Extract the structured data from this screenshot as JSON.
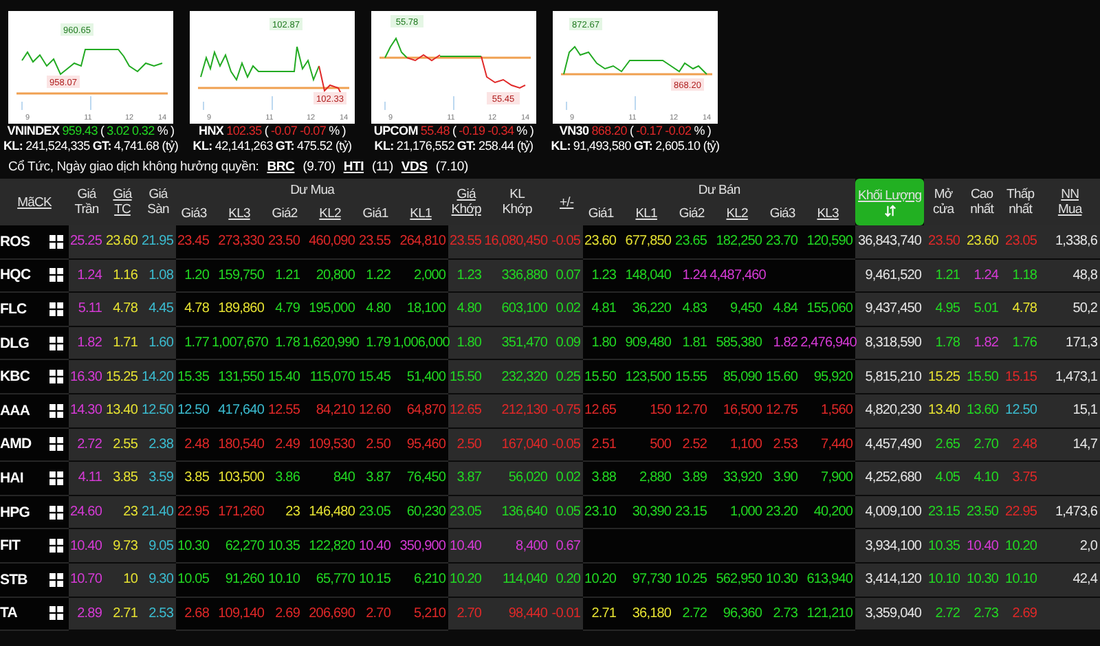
{
  "indices": [
    {
      "name": "VNINDEX",
      "value": "959.43",
      "color": "#22d822",
      "brackets": [
        "(",
        ")"
      ],
      "change": "3.02",
      "percent": "0.32",
      "unit": "%",
      "kl_label": "KL:",
      "kl": "241,524,335",
      "gt_label": "GT:",
      "gt": "4,741.68 (tỷ)",
      "high": "960.65",
      "low": "958.07",
      "ticks": [
        "9",
        "11",
        "12",
        "14"
      ]
    },
    {
      "name": "HNX",
      "value": "102.35",
      "color": "#e02828",
      "brackets": [
        "(",
        ")"
      ],
      "change": "-0.07",
      "percent": "-0.07",
      "unit": "%",
      "kl_label": "KL:",
      "kl": "42,141,263",
      "gt_label": "GT:",
      "gt": "475.52 (tỷ)",
      "high": "102.87",
      "low": "102.33",
      "ticks": [
        "9",
        "11",
        "12",
        "14"
      ]
    },
    {
      "name": "UPCOM",
      "value": "55.48",
      "color": "#e02828",
      "brackets": [
        "(",
        ")"
      ],
      "change": "-0.19",
      "percent": "-0.34",
      "unit": "%",
      "kl_label": "KL:",
      "kl": "21,176,552",
      "gt_label": "GT:",
      "gt": "258.44 (tỷ)",
      "high": "55.78",
      "low": "55.45",
      "ticks": [
        "9",
        "11",
        "12",
        "14"
      ]
    },
    {
      "name": "VN30",
      "value": "868.20",
      "color": "#e02828",
      "brackets": [
        "(",
        ")"
      ],
      "change": "-0.17",
      "percent": "-0.02",
      "unit": "%",
      "kl_label": "KL:",
      "kl": "91,493,580",
      "gt_label": "GT:",
      "gt": "2,605.10 (tỷ)",
      "high": "872.67",
      "low": "868.20",
      "ticks": [
        "9",
        "11",
        "12",
        "14"
      ]
    }
  ],
  "notice": {
    "label": "Cổ Tức, Ngày giao dịch không hưởng quyền:",
    "items": [
      {
        "symbol": "BRC",
        "value": "(9.70)"
      },
      {
        "symbol": "HTI",
        "value": "(11)"
      },
      {
        "symbol": "VDS",
        "value": "(7.10)"
      }
    ]
  },
  "table": {
    "columns": [
      {
        "label": "MãCK",
        "link": true,
        "sorted": false
      },
      {
        "label": "Giá\nTrần",
        "link": false,
        "sorted": false
      },
      {
        "label": "Giá\nTC",
        "link": true,
        "sorted": false
      },
      {
        "label": "Giá\nSàn",
        "link": false,
        "sorted": false
      },
      {
        "label": "Giá3",
        "link": false,
        "sorted": false
      },
      {
        "label": "KL3",
        "link": true,
        "sorted": false
      },
      {
        "label": "Giá2",
        "link": false,
        "sorted": false
      },
      {
        "label": "KL2",
        "link": true,
        "sorted": false
      },
      {
        "label": "Giá1",
        "link": false,
        "sorted": false
      },
      {
        "label": "KL1",
        "link": true,
        "sorted": false
      },
      {
        "label": "Giá\nKhớp",
        "link": true,
        "sorted": false
      },
      {
        "label": "KL\nKhớp",
        "link": false,
        "sorted": false
      },
      {
        "label": "+/-",
        "link": true,
        "sorted": false
      },
      {
        "label": "Giá1",
        "link": false,
        "sorted": false
      },
      {
        "label": "KL1",
        "link": true,
        "sorted": false
      },
      {
        "label": "Giá2",
        "link": false,
        "sorted": false
      },
      {
        "label": "KL2",
        "link": true,
        "sorted": false
      },
      {
        "label": "Giá3",
        "link": false,
        "sorted": false
      },
      {
        "label": "KL3",
        "link": true,
        "sorted": false
      },
      {
        "label": "Khối Lượng",
        "link": true,
        "sorted": true
      },
      {
        "label": "Mở\ncửa",
        "link": false,
        "sorted": false
      },
      {
        "label": "Cao\nnhất",
        "link": false,
        "sorted": false
      },
      {
        "label": "Thấp\nnhất",
        "link": false,
        "sorted": false
      },
      {
        "label": "NN\nMua",
        "link": true,
        "sorted": false
      }
    ],
    "column_groups": [
      {
        "label": "Dư Mua"
      },
      {
        "label": "Dư Bán"
      }
    ],
    "rows": [
      {
        "cells": [
          {
            "text": "ROS"
          },
          {
            "text": "25.25",
            "color": "#d63ad6"
          },
          {
            "text": "23.60",
            "color": "#e6e232"
          },
          {
            "text": "21.95",
            "color": "#3bbcd0"
          },
          {
            "text": "23.45",
            "color": "#e02828"
          },
          {
            "text": "273,330",
            "color": "#e02828"
          },
          {
            "text": "23.50",
            "color": "#e02828"
          },
          {
            "text": "460,090",
            "color": "#e02828"
          },
          {
            "text": "23.55",
            "color": "#e02828"
          },
          {
            "text": "264,810",
            "color": "#e02828"
          },
          {
            "text": "23.55",
            "color": "#e02828"
          },
          {
            "text": "16,080,450",
            "color": "#e02828"
          },
          {
            "text": "-0.05",
            "color": "#e02828"
          },
          {
            "text": "23.60",
            "color": "#e6e232"
          },
          {
            "text": "677,850",
            "color": "#e6e232"
          },
          {
            "text": "23.65",
            "color": "#22d822"
          },
          {
            "text": "182,250",
            "color": "#22d822"
          },
          {
            "text": "23.70",
            "color": "#22d822"
          },
          {
            "text": "120,590",
            "color": "#22d822"
          },
          {
            "text": "36,843,740",
            "color": "#e6e6e6"
          },
          {
            "text": "23.50",
            "color": "#e02828"
          },
          {
            "text": "23.60",
            "color": "#e6e232"
          },
          {
            "text": "23.05",
            "color": "#e02828"
          },
          {
            "text": "1,338,6",
            "color": "#e6e6e6"
          }
        ]
      },
      {
        "cells": [
          {
            "text": "HQC"
          },
          {
            "text": "1.24",
            "color": "#d63ad6"
          },
          {
            "text": "1.16",
            "color": "#e6e232"
          },
          {
            "text": "1.08",
            "color": "#3bbcd0"
          },
          {
            "text": "1.20",
            "color": "#22d822"
          },
          {
            "text": "159,750",
            "color": "#22d822"
          },
          {
            "text": "1.21",
            "color": "#22d822"
          },
          {
            "text": "20,800",
            "color": "#22d822"
          },
          {
            "text": "1.22",
            "color": "#22d822"
          },
          {
            "text": "2,000",
            "color": "#22d822"
          },
          {
            "text": "1.23",
            "color": "#22d822"
          },
          {
            "text": "336,880",
            "color": "#22d822"
          },
          {
            "text": "0.07",
            "color": "#22d822"
          },
          {
            "text": "1.23",
            "color": "#22d822"
          },
          {
            "text": "148,040",
            "color": "#22d822"
          },
          {
            "text": "1.24",
            "color": "#d63ad6"
          },
          {
            "text": "4,487,460",
            "color": "#d63ad6"
          },
          null,
          null,
          {
            "text": "9,461,520",
            "color": "#e6e6e6"
          },
          {
            "text": "1.21",
            "color": "#22d822"
          },
          {
            "text": "1.24",
            "color": "#d63ad6"
          },
          {
            "text": "1.18",
            "color": "#22d822"
          },
          {
            "text": "48,8",
            "color": "#e6e6e6"
          }
        ]
      },
      {
        "cells": [
          {
            "text": "FLC"
          },
          {
            "text": "5.11",
            "color": "#d63ad6"
          },
          {
            "text": "4.78",
            "color": "#e6e232"
          },
          {
            "text": "4.45",
            "color": "#3bbcd0"
          },
          {
            "text": "4.78",
            "color": "#e6e232"
          },
          {
            "text": "189,860",
            "color": "#e6e232"
          },
          {
            "text": "4.79",
            "color": "#22d822"
          },
          {
            "text": "195,000",
            "color": "#22d822"
          },
          {
            "text": "4.80",
            "color": "#22d822"
          },
          {
            "text": "18,100",
            "color": "#22d822"
          },
          {
            "text": "4.80",
            "color": "#22d822"
          },
          {
            "text": "603,100",
            "color": "#22d822"
          },
          {
            "text": "0.02",
            "color": "#22d822"
          },
          {
            "text": "4.81",
            "color": "#22d822"
          },
          {
            "text": "36,220",
            "color": "#22d822"
          },
          {
            "text": "4.83",
            "color": "#22d822"
          },
          {
            "text": "9,450",
            "color": "#22d822"
          },
          {
            "text": "4.84",
            "color": "#22d822"
          },
          {
            "text": "155,060",
            "color": "#22d822"
          },
          {
            "text": "9,437,450",
            "color": "#e6e6e6"
          },
          {
            "text": "4.95",
            "color": "#22d822"
          },
          {
            "text": "5.01",
            "color": "#22d822"
          },
          {
            "text": "4.78",
            "color": "#e6e232"
          },
          {
            "text": "50,2",
            "color": "#e6e6e6"
          }
        ]
      },
      {
        "cells": [
          {
            "text": "DLG"
          },
          {
            "text": "1.82",
            "color": "#d63ad6"
          },
          {
            "text": "1.71",
            "color": "#e6e232"
          },
          {
            "text": "1.60",
            "color": "#3bbcd0"
          },
          {
            "text": "1.77",
            "color": "#22d822"
          },
          {
            "text": "1,007,670",
            "color": "#22d822"
          },
          {
            "text": "1.78",
            "color": "#22d822"
          },
          {
            "text": "1,620,990",
            "color": "#22d822"
          },
          {
            "text": "1.79",
            "color": "#22d822"
          },
          {
            "text": "1,006,000",
            "color": "#22d822"
          },
          {
            "text": "1.80",
            "color": "#22d822"
          },
          {
            "text": "351,470",
            "color": "#22d822"
          },
          {
            "text": "0.09",
            "color": "#22d822"
          },
          {
            "text": "1.80",
            "color": "#22d822"
          },
          {
            "text": "909,480",
            "color": "#22d822"
          },
          {
            "text": "1.81",
            "color": "#22d822"
          },
          {
            "text": "585,380",
            "color": "#22d822"
          },
          {
            "text": "1.82",
            "color": "#d63ad6"
          },
          {
            "text": "2,476,940",
            "color": "#d63ad6"
          },
          {
            "text": "8,318,590",
            "color": "#e6e6e6"
          },
          {
            "text": "1.78",
            "color": "#22d822"
          },
          {
            "text": "1.82",
            "color": "#d63ad6"
          },
          {
            "text": "1.76",
            "color": "#22d822"
          },
          {
            "text": "171,3",
            "color": "#e6e6e6"
          }
        ]
      },
      {
        "cells": [
          {
            "text": "KBC"
          },
          {
            "text": "16.30",
            "color": "#d63ad6"
          },
          {
            "text": "15.25",
            "color": "#e6e232"
          },
          {
            "text": "14.20",
            "color": "#3bbcd0"
          },
          {
            "text": "15.35",
            "color": "#22d822"
          },
          {
            "text": "131,550",
            "color": "#22d822"
          },
          {
            "text": "15.40",
            "color": "#22d822"
          },
          {
            "text": "115,070",
            "color": "#22d822"
          },
          {
            "text": "15.45",
            "color": "#22d822"
          },
          {
            "text": "51,400",
            "color": "#22d822"
          },
          {
            "text": "15.50",
            "color": "#22d822"
          },
          {
            "text": "232,320",
            "color": "#22d822"
          },
          {
            "text": "0.25",
            "color": "#22d822"
          },
          {
            "text": "15.50",
            "color": "#22d822"
          },
          {
            "text": "123,500",
            "color": "#22d822"
          },
          {
            "text": "15.55",
            "color": "#22d822"
          },
          {
            "text": "85,090",
            "color": "#22d822"
          },
          {
            "text": "15.60",
            "color": "#22d822"
          },
          {
            "text": "95,920",
            "color": "#22d822"
          },
          {
            "text": "5,815,210",
            "color": "#e6e6e6"
          },
          {
            "text": "15.25",
            "color": "#e6e232"
          },
          {
            "text": "15.50",
            "color": "#22d822"
          },
          {
            "text": "15.15",
            "color": "#e02828"
          },
          {
            "text": "1,473,1",
            "color": "#e6e6e6"
          }
        ]
      },
      {
        "cells": [
          {
            "text": "AAA"
          },
          {
            "text": "14.30",
            "color": "#d63ad6"
          },
          {
            "text": "13.40",
            "color": "#e6e232"
          },
          {
            "text": "12.50",
            "color": "#3bbcd0"
          },
          {
            "text": "12.50",
            "color": "#3bbcd0"
          },
          {
            "text": "417,640",
            "color": "#3bbcd0"
          },
          {
            "text": "12.55",
            "color": "#e02828"
          },
          {
            "text": "84,210",
            "color": "#e02828"
          },
          {
            "text": "12.60",
            "color": "#e02828"
          },
          {
            "text": "64,870",
            "color": "#e02828"
          },
          {
            "text": "12.65",
            "color": "#e02828"
          },
          {
            "text": "212,130",
            "color": "#e02828"
          },
          {
            "text": "-0.75",
            "color": "#e02828"
          },
          {
            "text": "12.65",
            "color": "#e02828"
          },
          {
            "text": "150",
            "color": "#e02828"
          },
          {
            "text": "12.70",
            "color": "#e02828"
          },
          {
            "text": "16,500",
            "color": "#e02828"
          },
          {
            "text": "12.75",
            "color": "#e02828"
          },
          {
            "text": "1,560",
            "color": "#e02828"
          },
          {
            "text": "4,820,230",
            "color": "#e6e6e6"
          },
          {
            "text": "13.40",
            "color": "#e6e232"
          },
          {
            "text": "13.60",
            "color": "#22d822"
          },
          {
            "text": "12.50",
            "color": "#3bbcd0"
          },
          {
            "text": "15,1",
            "color": "#e6e6e6"
          }
        ]
      },
      {
        "cells": [
          {
            "text": "AMD"
          },
          {
            "text": "2.72",
            "color": "#d63ad6"
          },
          {
            "text": "2.55",
            "color": "#e6e232"
          },
          {
            "text": "2.38",
            "color": "#3bbcd0"
          },
          {
            "text": "2.48",
            "color": "#e02828"
          },
          {
            "text": "180,540",
            "color": "#e02828"
          },
          {
            "text": "2.49",
            "color": "#e02828"
          },
          {
            "text": "109,530",
            "color": "#e02828"
          },
          {
            "text": "2.50",
            "color": "#e02828"
          },
          {
            "text": "95,460",
            "color": "#e02828"
          },
          {
            "text": "2.50",
            "color": "#e02828"
          },
          {
            "text": "167,040",
            "color": "#e02828"
          },
          {
            "text": "-0.05",
            "color": "#e02828"
          },
          {
            "text": "2.51",
            "color": "#e02828"
          },
          {
            "text": "500",
            "color": "#e02828"
          },
          {
            "text": "2.52",
            "color": "#e02828"
          },
          {
            "text": "1,100",
            "color": "#e02828"
          },
          {
            "text": "2.53",
            "color": "#e02828"
          },
          {
            "text": "7,440",
            "color": "#e02828"
          },
          {
            "text": "4,457,490",
            "color": "#e6e6e6"
          },
          {
            "text": "2.65",
            "color": "#22d822"
          },
          {
            "text": "2.70",
            "color": "#22d822"
          },
          {
            "text": "2.48",
            "color": "#e02828"
          },
          {
            "text": "14,7",
            "color": "#e6e6e6"
          }
        ]
      },
      {
        "cells": [
          {
            "text": "HAI"
          },
          {
            "text": "4.11",
            "color": "#d63ad6"
          },
          {
            "text": "3.85",
            "color": "#e6e232"
          },
          {
            "text": "3.59",
            "color": "#3bbcd0"
          },
          {
            "text": "3.85",
            "color": "#e6e232"
          },
          {
            "text": "103,500",
            "color": "#e6e232"
          },
          {
            "text": "3.86",
            "color": "#22d822"
          },
          {
            "text": "840",
            "color": "#22d822"
          },
          {
            "text": "3.87",
            "color": "#22d822"
          },
          {
            "text": "76,450",
            "color": "#22d822"
          },
          {
            "text": "3.87",
            "color": "#22d822"
          },
          {
            "text": "56,020",
            "color": "#22d822"
          },
          {
            "text": "0.02",
            "color": "#22d822"
          },
          {
            "text": "3.88",
            "color": "#22d822"
          },
          {
            "text": "2,880",
            "color": "#22d822"
          },
          {
            "text": "3.89",
            "color": "#22d822"
          },
          {
            "text": "33,920",
            "color": "#22d822"
          },
          {
            "text": "3.90",
            "color": "#22d822"
          },
          {
            "text": "7,900",
            "color": "#22d822"
          },
          {
            "text": "4,252,680",
            "color": "#e6e6e6"
          },
          {
            "text": "4.05",
            "color": "#22d822"
          },
          {
            "text": "4.10",
            "color": "#22d822"
          },
          {
            "text": "3.75",
            "color": "#e02828"
          },
          null
        ]
      },
      {
        "cells": [
          {
            "text": "HPG"
          },
          {
            "text": "24.60",
            "color": "#d63ad6"
          },
          {
            "text": "23",
            "color": "#e6e232"
          },
          {
            "text": "21.40",
            "color": "#3bbcd0"
          },
          {
            "text": "22.95",
            "color": "#e02828"
          },
          {
            "text": "171,260",
            "color": "#e02828"
          },
          {
            "text": "23",
            "color": "#e6e232"
          },
          {
            "text": "146,480",
            "color": "#e6e232"
          },
          {
            "text": "23.05",
            "color": "#22d822"
          },
          {
            "text": "60,230",
            "color": "#22d822"
          },
          {
            "text": "23.05",
            "color": "#22d822"
          },
          {
            "text": "136,640",
            "color": "#22d822"
          },
          {
            "text": "0.05",
            "color": "#22d822"
          },
          {
            "text": "23.10",
            "color": "#22d822"
          },
          {
            "text": "30,390",
            "color": "#22d822"
          },
          {
            "text": "23.15",
            "color": "#22d822"
          },
          {
            "text": "1,000",
            "color": "#22d822"
          },
          {
            "text": "23.20",
            "color": "#22d822"
          },
          {
            "text": "40,200",
            "color": "#22d822"
          },
          {
            "text": "4,009,100",
            "color": "#e6e6e6"
          },
          {
            "text": "23.15",
            "color": "#22d822"
          },
          {
            "text": "23.50",
            "color": "#22d822"
          },
          {
            "text": "22.95",
            "color": "#e02828"
          },
          {
            "text": "1,473,6",
            "color": "#e6e6e6"
          }
        ]
      },
      {
        "cells": [
          {
            "text": "FIT"
          },
          {
            "text": "10.40",
            "color": "#d63ad6"
          },
          {
            "text": "9.73",
            "color": "#e6e232"
          },
          {
            "text": "9.05",
            "color": "#3bbcd0"
          },
          {
            "text": "10.30",
            "color": "#22d822"
          },
          {
            "text": "62,270",
            "color": "#22d822"
          },
          {
            "text": "10.35",
            "color": "#22d822"
          },
          {
            "text": "122,820",
            "color": "#22d822"
          },
          {
            "text": "10.40",
            "color": "#d63ad6"
          },
          {
            "text": "350,900",
            "color": "#d63ad6"
          },
          {
            "text": "10.40",
            "color": "#d63ad6"
          },
          {
            "text": "8,400",
            "color": "#d63ad6"
          },
          {
            "text": "0.67",
            "color": "#d63ad6"
          },
          null,
          null,
          null,
          null,
          null,
          null,
          {
            "text": "3,934,100",
            "color": "#e6e6e6"
          },
          {
            "text": "10.35",
            "color": "#22d822"
          },
          {
            "text": "10.40",
            "color": "#d63ad6"
          },
          {
            "text": "10.20",
            "color": "#22d822"
          },
          {
            "text": "2,0",
            "color": "#e6e6e6"
          }
        ]
      },
      {
        "cells": [
          {
            "text": "STB"
          },
          {
            "text": "10.70",
            "color": "#d63ad6"
          },
          {
            "text": "10",
            "color": "#e6e232"
          },
          {
            "text": "9.30",
            "color": "#3bbcd0"
          },
          {
            "text": "10.05",
            "color": "#22d822"
          },
          {
            "text": "91,260",
            "color": "#22d822"
          },
          {
            "text": "10.10",
            "color": "#22d822"
          },
          {
            "text": "65,770",
            "color": "#22d822"
          },
          {
            "text": "10.15",
            "color": "#22d822"
          },
          {
            "text": "6,210",
            "color": "#22d822"
          },
          {
            "text": "10.20",
            "color": "#22d822"
          },
          {
            "text": "114,040",
            "color": "#22d822"
          },
          {
            "text": "0.20",
            "color": "#22d822"
          },
          {
            "text": "10.20",
            "color": "#22d822"
          },
          {
            "text": "97,730",
            "color": "#22d822"
          },
          {
            "text": "10.25",
            "color": "#22d822"
          },
          {
            "text": "562,950",
            "color": "#22d822"
          },
          {
            "text": "10.30",
            "color": "#22d822"
          },
          {
            "text": "613,940",
            "color": "#22d822"
          },
          {
            "text": "3,414,120",
            "color": "#e6e6e6"
          },
          {
            "text": "10.10",
            "color": "#22d822"
          },
          {
            "text": "10.30",
            "color": "#22d822"
          },
          {
            "text": "10.10",
            "color": "#22d822"
          },
          {
            "text": "42,4",
            "color": "#e6e6e6"
          }
        ]
      },
      {
        "cells": [
          {
            "text": "TA"
          },
          {
            "text": "2.89",
            "color": "#d63ad6"
          },
          {
            "text": "2.71",
            "color": "#e6e232"
          },
          {
            "text": "2.53",
            "color": "#3bbcd0"
          },
          {
            "text": "2.68",
            "color": "#e02828"
          },
          {
            "text": "109,140",
            "color": "#e02828"
          },
          {
            "text": "2.69",
            "color": "#e02828"
          },
          {
            "text": "206,690",
            "color": "#e02828"
          },
          {
            "text": "2.70",
            "color": "#e02828"
          },
          {
            "text": "5,210",
            "color": "#e02828"
          },
          {
            "text": "2.70",
            "color": "#e02828"
          },
          {
            "text": "98,440",
            "color": "#e02828"
          },
          {
            "text": "-0.01",
            "color": "#e02828"
          },
          {
            "text": "2.71",
            "color": "#e6e232"
          },
          {
            "text": "36,180",
            "color": "#e6e232"
          },
          {
            "text": "2.72",
            "color": "#22d822"
          },
          {
            "text": "96,360",
            "color": "#22d822"
          },
          {
            "text": "2.73",
            "color": "#22d822"
          },
          {
            "text": "121,210",
            "color": "#22d822"
          },
          {
            "text": "3,359,040",
            "color": "#e6e6e6"
          },
          {
            "text": "2.72",
            "color": "#22d822"
          },
          {
            "text": "2.73",
            "color": "#22d822"
          },
          {
            "text": "2.69",
            "color": "#e02828"
          },
          null
        ]
      }
    ]
  }
}
